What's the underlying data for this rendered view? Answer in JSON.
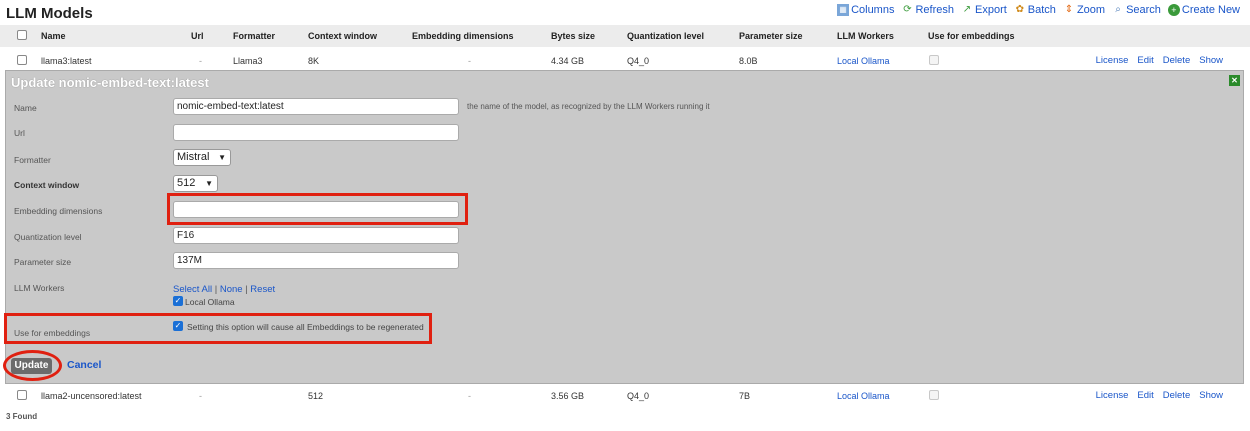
{
  "page": {
    "title": "LLM Models",
    "found": "3 Found"
  },
  "toolbar": [
    {
      "label": "Columns",
      "icon": "columns-icon"
    },
    {
      "label": "Refresh",
      "icon": "refresh-icon"
    },
    {
      "label": "Export",
      "icon": "export-icon"
    },
    {
      "label": "Batch",
      "icon": "batch-icon"
    },
    {
      "label": "Zoom",
      "icon": "zoom-icon"
    },
    {
      "label": "Search",
      "icon": "search-icon"
    },
    {
      "label": "Create New",
      "icon": "create-new-icon"
    }
  ],
  "columns": [
    "Name",
    "Url",
    "Formatter",
    "Context window",
    "Embedding dimensions",
    "Bytes size",
    "Quantization level",
    "Parameter size",
    "LLM Workers",
    "Use for embeddings"
  ],
  "rows": [
    {
      "name": "llama3:latest",
      "url": "-",
      "formatter": "Llama3",
      "context_window": "8K",
      "embedding_dimensions": "-",
      "bytes_size": "4.34 GB",
      "quantization": "Q4_0",
      "parameter_size": "8.0B",
      "workers": "Local Ollama"
    },
    {
      "name": "llama2-uncensored:latest",
      "url": "-",
      "formatter": "",
      "context_window": "512",
      "embedding_dimensions": "-",
      "bytes_size": "3.56 GB",
      "quantization": "Q4_0",
      "parameter_size": "7B",
      "workers": "Local Ollama"
    }
  ],
  "row_actions": [
    "License",
    "Edit",
    "Delete",
    "Show"
  ],
  "edit": {
    "title": "Update nomic-embed-text:latest",
    "fields": {
      "name": {
        "label": "Name",
        "value": "nomic-embed-text:latest",
        "hint": "the name of the model, as recognized by the LLM Workers running it"
      },
      "url": {
        "label": "Url",
        "value": ""
      },
      "formatter": {
        "label": "Formatter",
        "value": "Mistral"
      },
      "context_window": {
        "label": "Context window",
        "value": "512"
      },
      "embedding_dimensions": {
        "label": "Embedding dimensions",
        "value": ""
      },
      "quantization": {
        "label": "Quantization level",
        "value": "F16"
      },
      "parameter_size": {
        "label": "Parameter size",
        "value": "137M"
      },
      "workers": {
        "label": "LLM Workers",
        "select_all": "Select All",
        "none": "None",
        "reset": "Reset",
        "option": "Local Ollama"
      },
      "use_embeddings": {
        "label": "Use for embeddings",
        "hint": "Setting this option will cause all Embeddings to be regenerated"
      }
    },
    "update_label": "Update",
    "cancel_label": "Cancel"
  },
  "colors": {
    "link": "#1a56c9",
    "highlight": "#e02010",
    "panel": "#c9c9c9",
    "checkbox": "#1a6fd6"
  }
}
